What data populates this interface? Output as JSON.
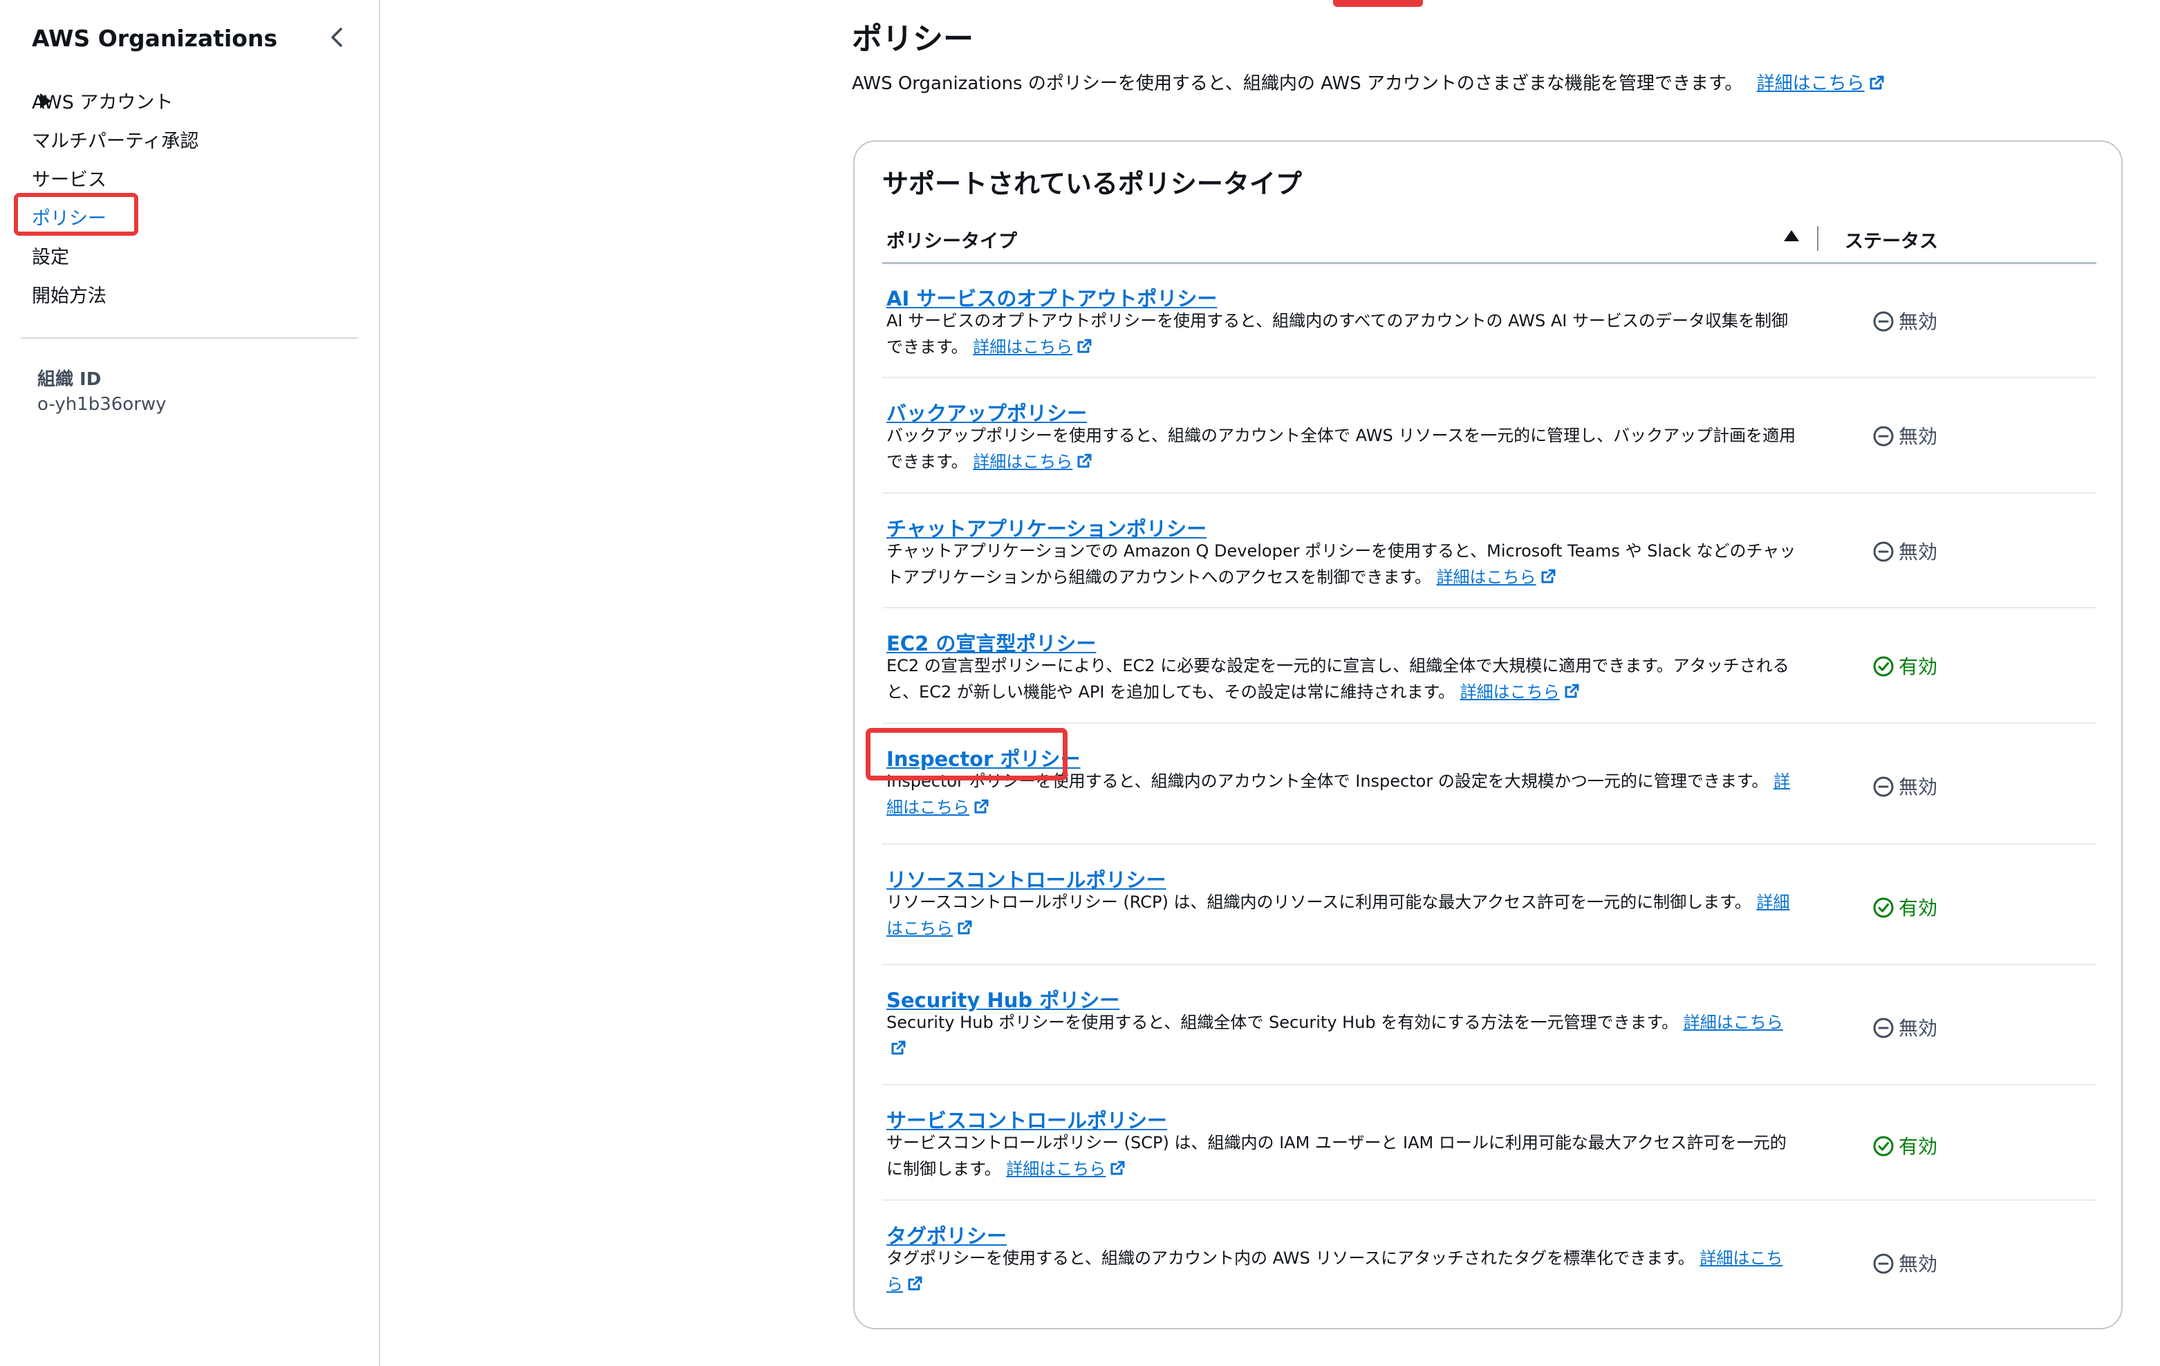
{
  "sidebar": {
    "title": "AWS Organizations",
    "items": [
      {
        "label": "AWS アカウント"
      },
      {
        "label": "マルチパーティ承認"
      },
      {
        "label": "サービス"
      },
      {
        "label": "ポリシー"
      },
      {
        "label": "設定"
      },
      {
        "label": "開始方法"
      }
    ],
    "org_id_label": "組織 ID",
    "org_id_value": "o-yh1b36orwy"
  },
  "main": {
    "title": "ポリシー",
    "description": "AWS Organizations のポリシーを使用すると、組織内の AWS アカウントのさまざまな機能を管理できます。",
    "learn_more": "詳細はこちら"
  },
  "card": {
    "title": "サポートされているポリシータイプ",
    "col_type": "ポリシータイプ",
    "col_status": "ステータス",
    "rows": [
      {
        "name": "AI サービスのオプトアウトポリシー",
        "desc": "AI サービスのオプトアウトポリシーを使用すると、組織内のすべてのアカウントの AWS AI サービスのデータ収集を制御できます。",
        "link": "詳細はこちら",
        "status": "無効"
      },
      {
        "name": "バックアップポリシー",
        "desc": "バックアップポリシーを使用すると、組織のアカウント全体で AWS リソースを一元的に管理し、バックアップ計画を適用できます。",
        "link": "詳細はこちら",
        "status": "無効"
      },
      {
        "name": "チャットアプリケーションポリシー",
        "desc": "チャットアプリケーションでの Amazon Q Developer ポリシーを使用すると、Microsoft Teams や Slack などのチャットアプリケーションから組織のアカウントへのアクセスを制御できます。",
        "link": "詳細はこちら",
        "status": "無効"
      },
      {
        "name": "EC2 の宣言型ポリシー",
        "desc": "EC2 の宣言型ポリシーにより、EC2 に必要な設定を一元的に宣言し、組織全体で大規模に適用できます。アタッチされると、EC2 が新しい機能や API を追加しても、その設定は常に維持されます。",
        "link": "詳細はこちら",
        "status": "有効"
      },
      {
        "name": "Inspector ポリシー",
        "desc": "Inspector ポリシーを使用すると、組織内のアカウント全体で Inspector の設定を大規模かつ一元的に管理できます。",
        "link": "詳細はこちら",
        "status": "無効"
      },
      {
        "name": "リソースコントロールポリシー",
        "desc": "リソースコントロールポリシー (RCP) は、組織内のリソースに利用可能な最大アクセス許可を一元的に制御します。",
        "link": "詳細はこちら",
        "status": "有効"
      },
      {
        "name": "Security Hub ポリシー",
        "desc": "Security Hub ポリシーを使用すると、組織全体で Security Hub を有効にする方法を一元管理できます。",
        "link": "詳細はこちら",
        "status": "無効"
      },
      {
        "name": "サービスコントロールポリシー",
        "desc": "サービスコントロールポリシー (SCP) は、組織内の IAM ユーザーと IAM ロールに利用可能な最大アクセス許可を一元的に制御します。",
        "link": "詳細はこちら",
        "status": "有効"
      },
      {
        "name": "タグポリシー",
        "desc": "タグポリシーを使用すると、組織のアカウント内の AWS リソースにアタッチされたタグを標準化できます。",
        "link": "詳細はこちら",
        "status": "無効"
      }
    ]
  },
  "colors": {
    "link": "#0972d3",
    "enabled": "#037f0c",
    "disabled": "#414d5c",
    "highlight": "#e8393a"
  }
}
